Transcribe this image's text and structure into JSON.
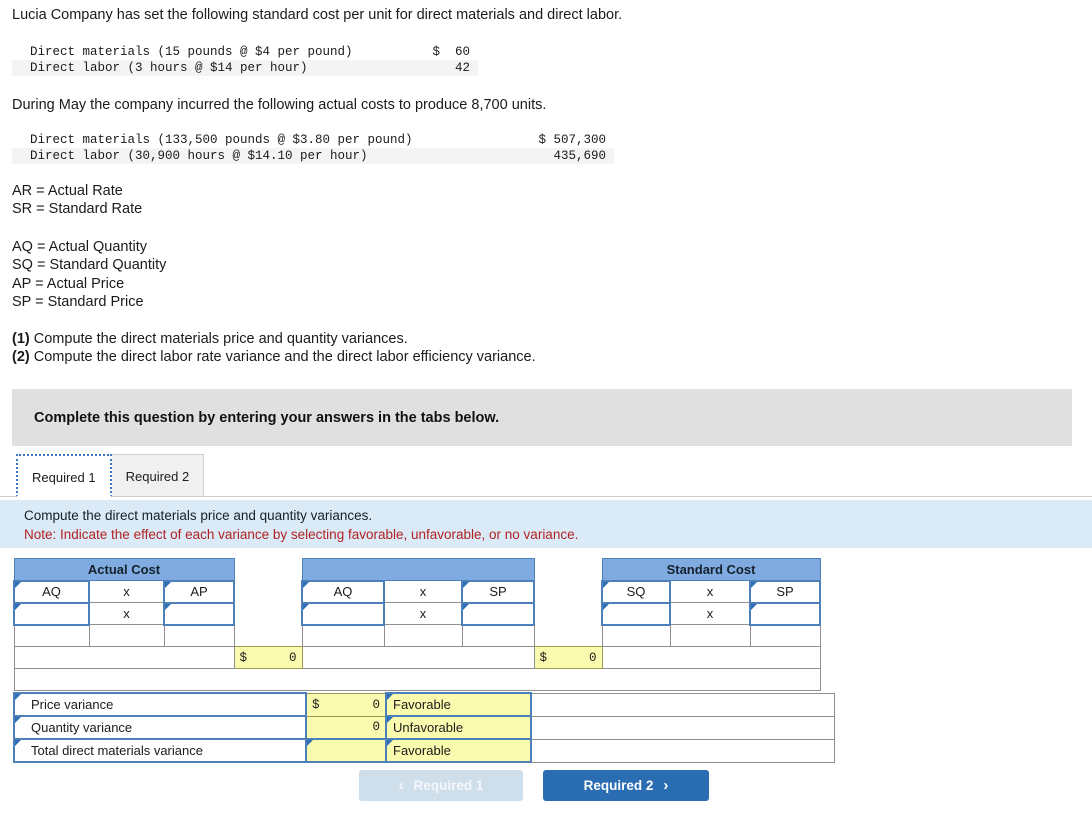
{
  "intro": {
    "line1": "Lucia Company has set the following standard cost per unit for direct materials and direct labor.",
    "line2": "During May the company incurred the following actual costs to produce 8,700 units."
  },
  "standard_cost_table": {
    "rows": [
      {
        "label": "Direct materials (15 pounds @ $4 per pound)",
        "amount": "$  60"
      },
      {
        "label": "Direct labor (3 hours @ $14 per hour)",
        "amount": "42"
      }
    ]
  },
  "actual_cost_table": {
    "rows": [
      {
        "label": "Direct materials (133,500 pounds @ $3.80 per pound)",
        "amount": "$ 507,300"
      },
      {
        "label": "Direct labor (30,900 hours @ $14.10 per hour)",
        "amount": "435,690"
      }
    ]
  },
  "definitions": {
    "rate": [
      "AR = Actual Rate",
      "SR = Standard Rate"
    ],
    "quantity": [
      "AQ = Actual Quantity",
      "SQ = Standard Quantity",
      "AP = Actual Price",
      "SP = Standard Price"
    ]
  },
  "requirements": [
    {
      "num": "(1)",
      "text": " Compute the direct materials price and quantity variances."
    },
    {
      "num": "(2)",
      "text": " Compute the direct labor rate variance and the direct labor efficiency variance."
    }
  ],
  "banner": {
    "text": "Complete this question by entering your answers in the tabs below."
  },
  "tabs": [
    {
      "label": "Required 1",
      "active": true
    },
    {
      "label": "Required 2",
      "active": false
    }
  ],
  "note": {
    "line1": "Compute the direct materials price and quantity variances.",
    "line2": "Note: Indicate the effect of each variance by selecting favorable, unfavorable, or no variance."
  },
  "worksheet": {
    "group_headers": {
      "actual_cost": "Actual Cost",
      "middle": "",
      "standard_cost": "Standard Cost"
    },
    "column_labels": {
      "left": {
        "q": "AQ",
        "op": "x",
        "p": "AP"
      },
      "middle": {
        "q": "AQ",
        "op": "x",
        "p": "SP"
      },
      "right": {
        "q": "SQ",
        "op": "x",
        "p": "SP"
      }
    },
    "entry_row": {
      "left": {
        "q": "",
        "op": "x",
        "p": ""
      },
      "middle": {
        "q": "",
        "op": "x",
        "p": ""
      },
      "right": {
        "q": "",
        "op": "x",
        "p": ""
      }
    },
    "result_row": {
      "left": {
        "q": "",
        "op": "",
        "p": ""
      },
      "middle": {
        "q": "",
        "op": "",
        "p": ""
      },
      "right": {
        "q": "",
        "op": "",
        "p": ""
      }
    },
    "totals": {
      "left_gap": {
        "currency": "$",
        "value": "0"
      },
      "right_gap": {
        "currency": "$",
        "value": "0"
      }
    }
  },
  "variances": {
    "rows": [
      {
        "label": "Price variance",
        "currency": "$",
        "amount": "0",
        "effect": "Favorable"
      },
      {
        "label": "Quantity variance",
        "currency": "",
        "amount": "0",
        "effect": "Unfavorable"
      },
      {
        "label": "Total direct materials variance",
        "currency": "",
        "amount": "",
        "effect": "Favorable"
      }
    ]
  },
  "nav": {
    "prev": {
      "label": "Required 1",
      "chevron": "‹"
    },
    "next": {
      "label": "Required 2",
      "chevron": "›"
    }
  },
  "colors": {
    "header_blue": "#7fabe0",
    "note_blue": "#daeaf7",
    "banner_gray": "#e0e0e0",
    "input_yellow": "#fbfbaf",
    "input_border": "#4d7fb8",
    "primary_button": "#2a6db3",
    "disabled_button": "#cfdeeb",
    "note_red": "#b22222"
  }
}
